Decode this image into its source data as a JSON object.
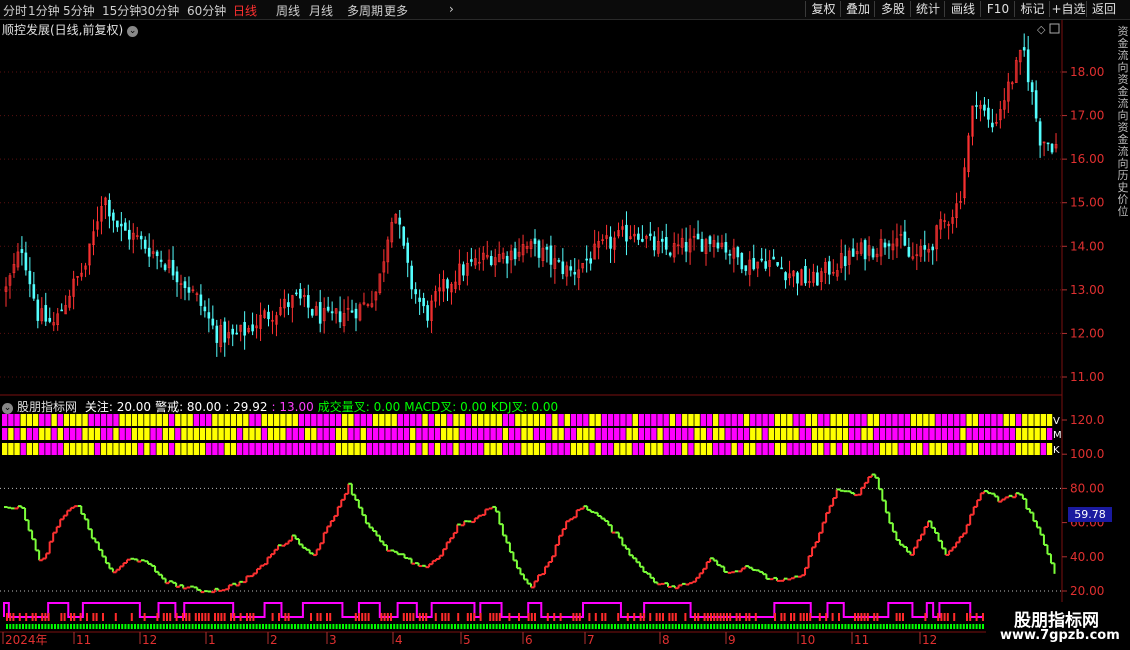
{
  "toolbar": {
    "periods": [
      "分时",
      "1分钟",
      "5分钟",
      "15分钟",
      "30分钟",
      "60分钟",
      "日线",
      "周线",
      "月线",
      "多周期",
      "更多"
    ],
    "active_period": "日线",
    "buttons": [
      "复权",
      "叠加",
      "多股",
      "统计",
      "画线",
      "F10",
      "标记",
      "+自选",
      "返回"
    ]
  },
  "main_chart": {
    "title": "顺控发展(日线,前复权)",
    "price_labels": [
      "18.00",
      "17.00",
      "16.00",
      "15.00",
      "14.00",
      "13.00",
      "12.00",
      "11.00"
    ],
    "price_values": [
      18,
      17,
      16,
      15,
      14,
      13,
      12,
      11
    ]
  },
  "indicator": {
    "name": "股朋指标网",
    "items": [
      {
        "label": "关注: 20.00",
        "color": "#ffffff"
      },
      {
        "label": "警戒: 80.00",
        "color": "#ffffff"
      },
      {
        "label": ": 29.92",
        "color": "#ffffff"
      },
      {
        "label": ": 13.00",
        "color": "#ff40ff"
      },
      {
        "label": "成交量叉: 0.00",
        "color": "#00ff00"
      },
      {
        "label": "MACD叉: 0.00",
        "color": "#00ff00"
      },
      {
        "label": "KDJ叉: 0.00",
        "color": "#00ff00"
      }
    ],
    "row_labels": [
      "V",
      "M",
      "K"
    ],
    "scale_labels": [
      "120.0",
      "100.0",
      "80.00",
      "60.00",
      "40.00",
      "20.00"
    ],
    "scale_values": [
      120,
      100,
      80,
      60,
      40,
      20
    ],
    "current_value": "59.78"
  },
  "time_axis": [
    "2024年",
    "11",
    "12",
    "1",
    "2",
    "3",
    "4",
    "5",
    "6",
    "7",
    "8",
    "9",
    "10",
    "11",
    "12"
  ],
  "right_vertical_text": "资金流向资金流向资金流向历史价位",
  "watermark": {
    "cn": "股朋指标网",
    "url": "www.7gpzb.com"
  },
  "colors": {
    "up": "#ff3232",
    "down": "#54ffff",
    "magenta": "#ff00ff",
    "yellow": "#ffff00",
    "green": "#00ff00"
  },
  "chart_data": {
    "type": "candlestick",
    "price_axis": {
      "min": 11,
      "max": 18
    },
    "oscillator_axis": {
      "min": 20,
      "max": 120
    },
    "price_path": [
      13.0,
      14.0,
      12.4,
      12.2,
      13.0,
      13.6,
      15.2,
      14.4,
      14.2,
      13.9,
      13.6,
      13.2,
      12.7,
      12.0,
      11.9,
      12.1,
      12.4,
      12.6,
      12.8,
      12.5,
      12.3,
      12.5,
      12.6,
      13.0,
      15.0,
      13.2,
      12.4,
      13.0,
      13.4,
      13.6,
      13.8,
      13.8,
      14.0,
      13.9,
      13.6,
      13.4,
      13.7,
      14.0,
      14.2,
      14.4,
      14.0,
      13.9,
      14.0,
      14.1,
      14.2,
      13.8,
      13.6,
      13.7,
      13.5,
      13.3,
      13.2,
      13.5,
      13.7,
      13.9,
      14.0,
      14.3,
      13.7,
      13.9,
      14.5,
      15.0,
      17.5,
      16.7,
      17.6,
      18.5,
      16.5,
      16.3
    ],
    "oscillator_path": [
      70,
      68,
      35,
      60,
      72,
      48,
      30,
      40,
      35,
      25,
      22,
      20,
      21,
      25,
      32,
      45,
      52,
      40,
      60,
      82,
      60,
      45,
      40,
      33,
      40,
      58,
      62,
      70,
      40,
      22,
      35,
      60,
      70,
      62,
      50,
      35,
      25,
      22,
      25,
      40,
      30,
      35,
      28,
      26,
      28,
      55,
      80,
      75,
      90,
      55,
      40,
      62,
      40,
      55,
      80,
      72,
      78,
      58,
      30
    ]
  }
}
